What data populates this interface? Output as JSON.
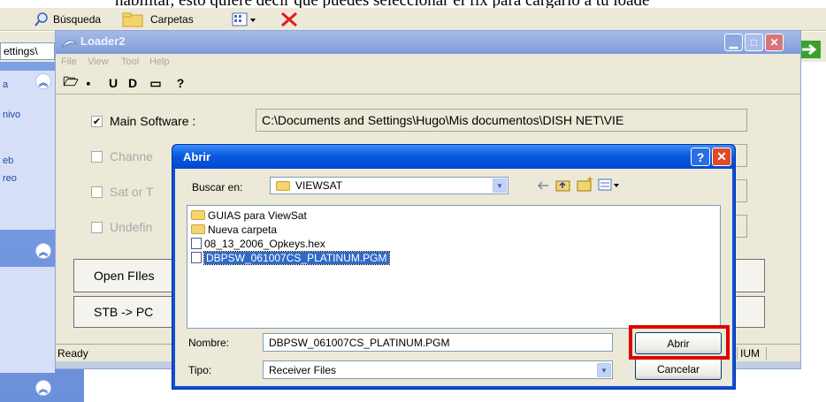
{
  "background": {
    "instruction_text": "habilitar, esto quiere decir que puedes seleccionar el flx para cargarlo a tu loade",
    "toolbar": {
      "search_label": "Búsqueda",
      "folders_label": "Carpetas"
    },
    "address_settings_text": "ettings\\",
    "left_pane": {
      "items": [
        "a",
        "nivo",
        "eb",
        "reo"
      ]
    }
  },
  "loader": {
    "title": "Loader2",
    "menu": [
      "File",
      "View",
      "Tool",
      "Help"
    ],
    "rows": [
      {
        "label": "Main Software :",
        "checked": true,
        "value": "C:\\Documents and Settings\\Hugo\\Mis documentos\\DISH NET\\VIE"
      },
      {
        "label": "Channe",
        "checked": false,
        "value": ""
      },
      {
        "label": "Sat or T",
        "checked": false,
        "value": ""
      },
      {
        "label": "Undefin",
        "checked": false,
        "value": ""
      }
    ],
    "buttons": {
      "open_files": "Open FIles",
      "stb_to_pc": "STB -> PC"
    },
    "status": {
      "left": "Ready",
      "right": "IUM"
    }
  },
  "dialog": {
    "title": "Abrir",
    "look_in_label": "Buscar en:",
    "look_in_value": "VIEWSAT",
    "files": [
      {
        "name": "GUIAS para ViewSat",
        "type": "folder",
        "selected": false
      },
      {
        "name": "Nueva carpeta",
        "type": "folder",
        "selected": false
      },
      {
        "name": "08_13_2006_Opkeys.hex",
        "type": "file",
        "selected": false
      },
      {
        "name": "DBPSW_061007CS_PLATINUM.PGM",
        "type": "file",
        "selected": true
      }
    ],
    "name_label": "Nombre:",
    "name_value": "DBPSW_061007CS_PLATINUM.PGM",
    "type_label": "Tipo:",
    "type_value": "Receiver Files",
    "open_button": "Abrir",
    "cancel_button": "Cancelar",
    "help_symbol": "?",
    "close_symbol": "✕"
  },
  "colors": {
    "highlight": "#e00000",
    "selection": "#316ac5",
    "title_blue": "#0a5ae0"
  }
}
